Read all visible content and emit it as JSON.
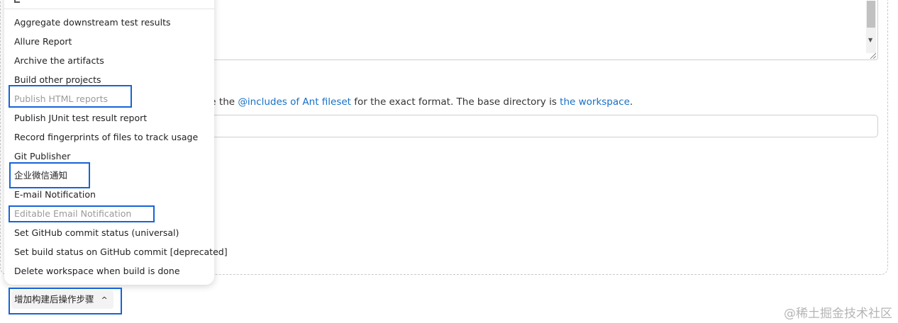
{
  "help_text": {
    "prefix": "ee the ",
    "link1": "@includes of Ant fileset",
    "middle": " for the exact format. The base directory is ",
    "link2": "the workspace",
    "suffix": "."
  },
  "menu": {
    "items": [
      {
        "label": "Aggregate downstream test results",
        "disabled": false
      },
      {
        "label": "Allure Report",
        "disabled": false
      },
      {
        "label": "Archive the artifacts",
        "disabled": false
      },
      {
        "label": "Build other projects",
        "disabled": false
      },
      {
        "label": "Publish HTML reports",
        "disabled": true
      },
      {
        "label": "Publish JUnit test result report",
        "disabled": false
      },
      {
        "label": "Record fingerprints of files to track usage",
        "disabled": false
      },
      {
        "label": "Git Publisher",
        "disabled": false
      },
      {
        "label": "企业微信通知",
        "disabled": false
      },
      {
        "label": "E-mail Notification",
        "disabled": false
      },
      {
        "label": "Editable Email Notification",
        "disabled": true
      },
      {
        "label": "Set GitHub commit status (universal)",
        "disabled": false
      },
      {
        "label": "Set build status on GitHub commit [deprecated]",
        "disabled": false
      },
      {
        "label": "Delete workspace when build is done",
        "disabled": false
      }
    ]
  },
  "add_step_button": {
    "label": "增加构建后操作步骤",
    "icon": "chevron-up-icon"
  },
  "watermark": "@稀土掘金技术社区",
  "colors": {
    "link": "#1670c5",
    "highlight_border": "#1664d6",
    "disabled_text": "#9a9a9a"
  }
}
